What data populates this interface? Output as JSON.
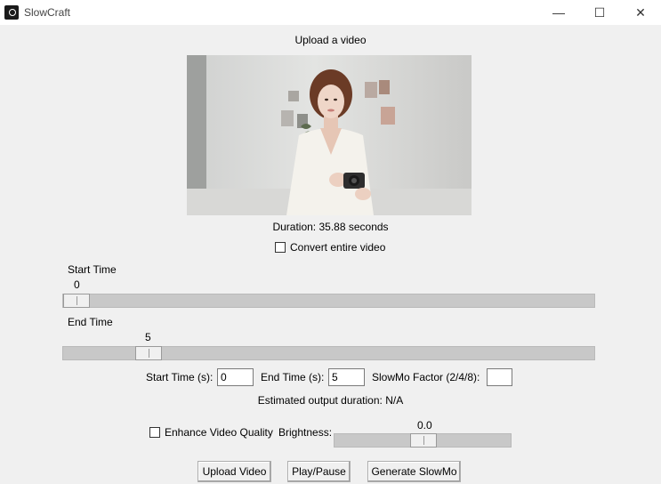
{
  "window": {
    "title": "SlowCraft",
    "minimize": "—",
    "maximize": "☐",
    "close": "✕"
  },
  "upload_heading": "Upload a video",
  "duration_text": "Duration: 35.88 seconds",
  "convert_entire_label": "Convert entire video",
  "start_slider": {
    "label": "Start Time",
    "value": "0"
  },
  "end_slider": {
    "label": "End Time",
    "value": "5"
  },
  "fields": {
    "start_label": "Start Time (s):",
    "start_value": "0",
    "end_label": "End Time (s):",
    "end_value": "5",
    "factor_label": "SlowMo Factor (2/4/8):",
    "factor_value": ""
  },
  "estimated_text": "Estimated output duration: N/A",
  "enhance_label": "Enhance Video Quality",
  "brightness_label": "Brightness:",
  "brightness_value": "0.0",
  "buttons": {
    "upload": "Upload Video",
    "play": "Play/Pause",
    "generate": "Generate SlowMo"
  }
}
